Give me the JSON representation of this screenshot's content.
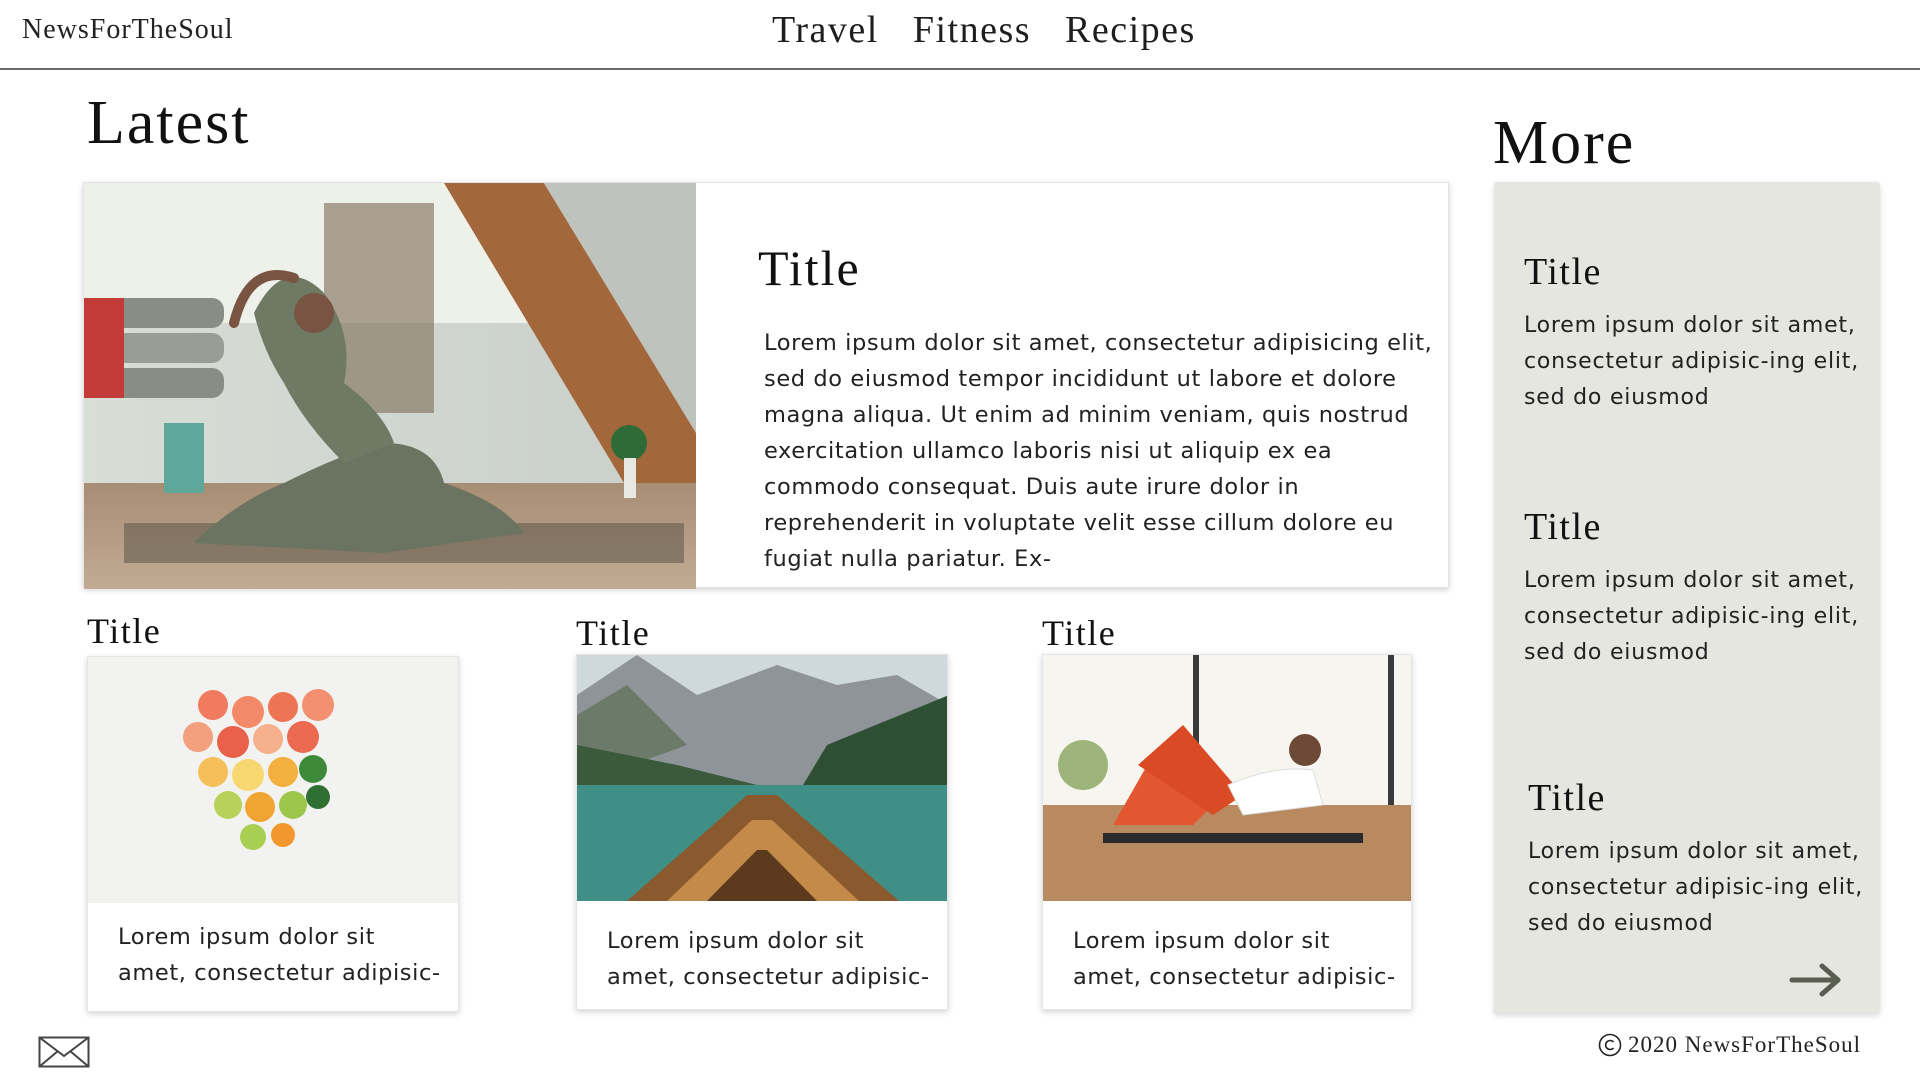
{
  "header": {
    "logo": "NewsForTheSoul",
    "nav": [
      "Travel",
      "Fitness",
      "Recipes"
    ]
  },
  "latest": {
    "heading": "Latest",
    "featured": {
      "title": "Title",
      "text": "Lorem ipsum dolor sit amet, consectetur adipisicing elit, sed do eiusmod tempor incididunt ut labore et dolore magna aliqua. Ut enim ad minim veniam, quis nostrud exercitation ullamco laboris nisi ut aliquip ex ea commodo consequat. Duis aute irure dolor in reprehenderit in voluptate velit esse cillum dolore eu fugiat nulla pariatur. Ex-",
      "image": "yoga-pose-photo"
    },
    "cards": [
      {
        "title": "Title",
        "text": "Lorem ipsum dolor sit amet, consectetur adipisic-",
        "image": "citrus-fruit-photo"
      },
      {
        "title": "Title",
        "text": "Lorem ipsum dolor sit amet, consectetur adipisic-",
        "image": "boat-lake-mountains-photo"
      },
      {
        "title": "Title",
        "text": "Lorem ipsum dolor sit amet, consectetur adipisic-",
        "image": "woman-exercising-photo"
      }
    ]
  },
  "more": {
    "heading": "More",
    "items": [
      {
        "title": "Title",
        "text": "Lorem ipsum dolor sit amet, consectetur adipisic-ing elit, sed do eiusmod"
      },
      {
        "title": "Title",
        "text": "Lorem ipsum dolor sit amet, consectetur adipisic-ing elit, sed do eiusmod"
      },
      {
        "title": "Title",
        "text": "Lorem ipsum dolor sit amet, consectetur adipisic-ing elit, sed do eiusmod"
      }
    ],
    "arrow_icon": "arrow-right-icon"
  },
  "footer": {
    "mail_icon": "mail-icon",
    "copyright": "2020 NewsForTheSoul"
  },
  "colors": {
    "sidebar_bg": "#e5e6df",
    "text": "#1e1e1e",
    "divider": "#6a6a6a"
  }
}
